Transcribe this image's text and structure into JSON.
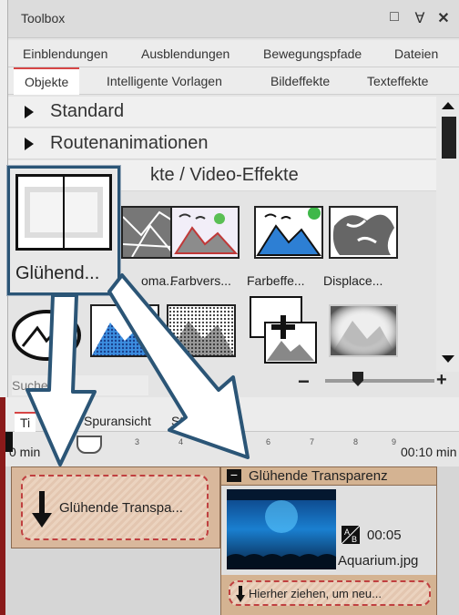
{
  "toolbox": {
    "title": "Toolbox",
    "window_buttons": {
      "restore": "□",
      "pin": "Ɐ",
      "close": "✕"
    },
    "tabs_row1": [
      {
        "label": "Einblendungen"
      },
      {
        "label": "Ausblendungen"
      },
      {
        "label": "Bewegungspfade"
      },
      {
        "label": "Dateien"
      }
    ],
    "tabs_row2": [
      {
        "label": "Objekte",
        "active": true
      },
      {
        "label": "Intelligente Vorlagen"
      },
      {
        "label": "Bildeffekte"
      },
      {
        "label": "Texteffekte"
      }
    ],
    "sections": [
      {
        "label": "Standard"
      },
      {
        "label": "Routenanimationen"
      },
      {
        "label": "kte / Video-Effekte"
      }
    ],
    "effects_row1": [
      {
        "label": "oma..."
      },
      {
        "label": "Farbvers..."
      },
      {
        "label": "Farbeffe..."
      },
      {
        "label": "Displace..."
      }
    ],
    "search_placeholder": "Suchen",
    "zoom_minus": "−",
    "zoom_plus": "+"
  },
  "popup": {
    "label": "Glühend..."
  },
  "timeline": {
    "tabs": [
      {
        "label": "Ti"
      },
      {
        "label": "Spuransicht"
      },
      {
        "label": "Sto"
      }
    ],
    "ruler": {
      "start_label": "0 min",
      "end_label": "00:10 min",
      "ticks": [
        "3",
        "4",
        "5",
        "6",
        "7",
        "8",
        "9"
      ]
    },
    "drag_block_label": "Glühende Transpa...",
    "effect_header": "Glühende Transparenz",
    "effect_collapse": "−",
    "clip_duration": "00:05",
    "clip_filename": "Aquarium.jpg",
    "drop_hint": "Hierher ziehen, um neu..."
  },
  "colors": {
    "accent": "#d64545",
    "popup_border": "#2b5576",
    "arrow_fill": "#ffffff",
    "arrow_stroke": "#2b5576"
  }
}
